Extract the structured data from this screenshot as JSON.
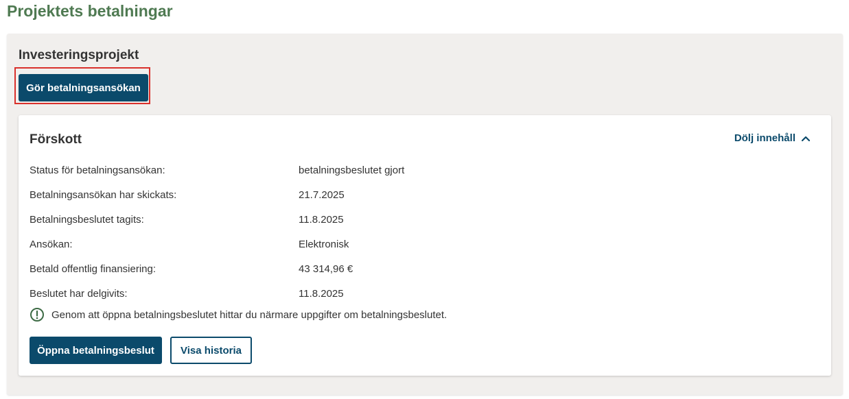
{
  "page": {
    "title": "Projektets betalningar"
  },
  "project": {
    "heading": "Investeringsprojekt",
    "payment_application_button": "Gör betalningsansökan"
  },
  "card": {
    "title": "Förskott",
    "toggle_label": "Dölj innehåll",
    "rows": [
      {
        "label": "Status för betalningsansökan:",
        "value": "betalningsbeslutet gjort"
      },
      {
        "label": "Betalningsansökan har skickats:",
        "value": "21.7.2025"
      },
      {
        "label": "Betalningsbeslutet tagits:",
        "value": "11.8.2025"
      },
      {
        "label": "Ansökan:",
        "value": "Elektronisk"
      },
      {
        "label": "Betald offentlig finansiering:",
        "value": "43 314,96 €"
      },
      {
        "label": "Beslutet har delgivits:",
        "value": "11.8.2025"
      }
    ],
    "notice": "Genom att öppna betalningsbeslutet hittar du närmare uppgifter om betalningsbeslutet.",
    "open_decision_button": "Öppna betalningsbeslut",
    "history_button": "Visa historia"
  },
  "icons": {
    "toggle": "chevron-up-icon",
    "notice": "info-circle-icon"
  },
  "colors": {
    "title_green": "#4f7a52",
    "primary_blue": "#0b4a6b",
    "panel_bg": "#f1efed",
    "highlight_red": "#d9302b",
    "notice_icon_green": "#3d6b45"
  }
}
